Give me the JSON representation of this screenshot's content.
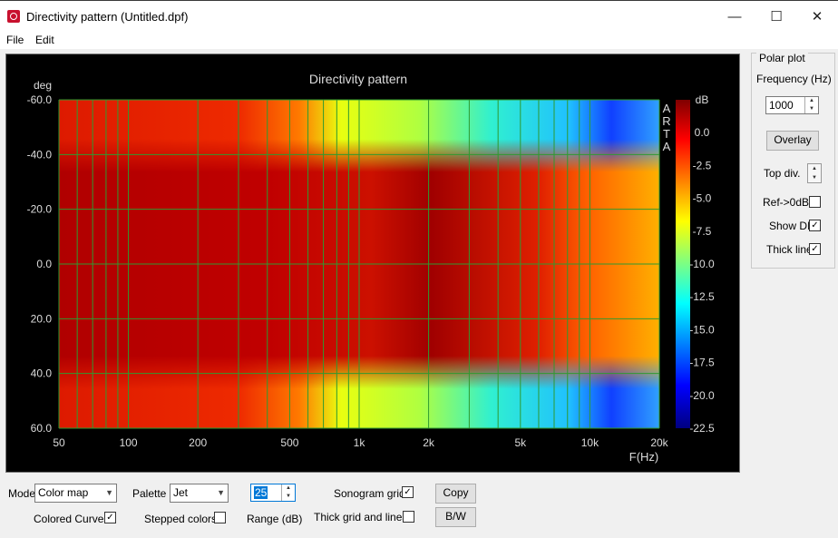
{
  "window": {
    "title": "Directivity pattern (Untitled.dpf)",
    "minimize": "—",
    "maximize": "☐",
    "close": "✕"
  },
  "menu": {
    "file": "File",
    "edit": "Edit"
  },
  "chart_data": {
    "type": "heatmap",
    "title": "Directivity pattern",
    "xlabel": "F(Hz)",
    "ylabel": "deg",
    "x_scale": "log",
    "xlim": [
      50,
      20000
    ],
    "ylim": [
      -60,
      60
    ],
    "x_ticks": [
      50,
      100,
      200,
      500,
      1000,
      2000,
      5000,
      10000,
      20000
    ],
    "x_tick_labels": [
      "50",
      "100",
      "200",
      "500",
      "1k",
      "2k",
      "5k",
      "10k",
      "20k"
    ],
    "y_tick_labels": [
      "-60.0",
      "-40.0",
      "-20.0",
      "0.0",
      "20.0",
      "40.0",
      "60.0"
    ],
    "colorbar_unit": "dB",
    "colorbar_labels": [
      "0.0",
      "-2.5",
      "-5.0",
      "-7.5",
      "-10.0",
      "-12.5",
      "-15.0",
      "-17.5",
      "-20.0",
      "-22.5"
    ],
    "colorbar_range": [
      -22.5,
      2.5
    ],
    "palette": "Jet",
    "watermark": "ARTA",
    "grid_color": "#2f9a2f",
    "grid": true
  },
  "polar": {
    "title": "Polar plot",
    "frequency_label": "Frequency (Hz)",
    "frequency_value": "1000",
    "overlay_label": "Overlay",
    "top_div_label": "Top div.",
    "ref_label": "Ref->0dB",
    "ref_checked": false,
    "show_di_label": "Show DI",
    "show_di_checked": true,
    "thick_line_label": "Thick line",
    "thick_line_checked": true
  },
  "controls": {
    "mode_label": "Mode",
    "mode_value": "Color map",
    "palette_label": "Palette",
    "palette_value": "Jet",
    "range_value": "25",
    "range_label": "Range (dB)",
    "sonogram_grid_label": "Sonogram grid",
    "sonogram_grid_checked": true,
    "copy_label": "Copy",
    "colored_curves_label": "Colored Curves",
    "colored_curves_checked": true,
    "stepped_colors_label": "Stepped colors",
    "stepped_colors_checked": false,
    "thick_grid_label": "Thick grid and  lines",
    "thick_grid_checked": false,
    "bw_label": "B/W"
  }
}
